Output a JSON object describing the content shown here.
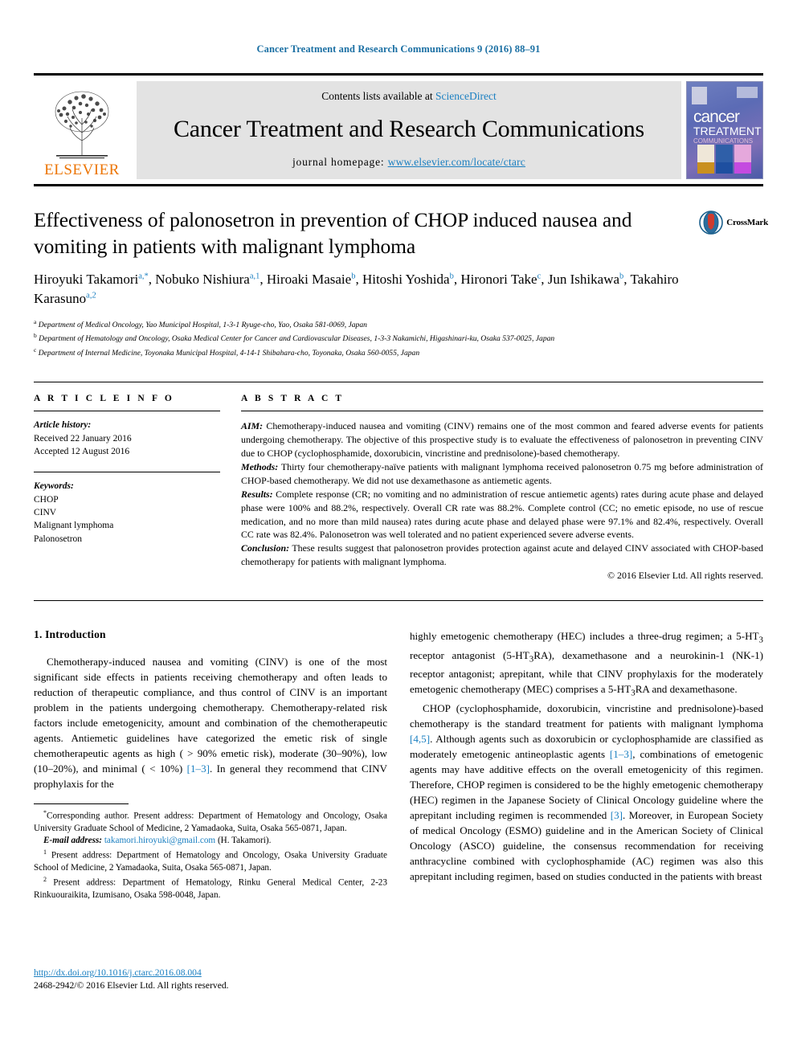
{
  "running_head": "Cancer Treatment and Research Communications 9 (2016) 88–91",
  "masthead": {
    "contents_prefix": "Contents lists available at ",
    "sciencedirect": "ScienceDirect",
    "journal_title": "Cancer Treatment and Research Communications",
    "homepage_prefix": "journal homepage: ",
    "homepage_url": "www.elsevier.com/locate/ctarc",
    "publisher_wordmark": "ELSEVIER",
    "cover": {
      "line1": "cancer",
      "line2": "TREATMENT",
      "line3": "COMMUNICATIONS"
    }
  },
  "article": {
    "title": "Effectiveness of palonosetron in prevention of CHOP induced nausea and vomiting in patients with malignant lymphoma",
    "crossmark_label": "CrossMark",
    "authors": [
      {
        "name": "Hiroyuki Takamori",
        "marks": "a,*"
      },
      {
        "name": "Nobuko Nishiura",
        "marks": "a,1"
      },
      {
        "name": "Hiroaki Masaie",
        "marks": "b"
      },
      {
        "name": "Hitoshi Yoshida",
        "marks": "b"
      },
      {
        "name": "Hironori Take",
        "marks": "c"
      },
      {
        "name": "Jun Ishikawa",
        "marks": "b"
      },
      {
        "name": "Takahiro Karasuno",
        "marks": "a,2"
      }
    ],
    "affiliations": [
      {
        "mark": "a",
        "text": "Department of Medical Oncology, Yao Municipal Hospital, 1-3-1 Ryuge-cho, Yao, Osaka 581-0069, Japan"
      },
      {
        "mark": "b",
        "text": "Department of Hematology and Oncology, Osaka Medical Center for Cancer and Cardiovascular Diseases, 1-3-3 Nakamichi, Higashinari-ku, Osaka 537-0025, Japan"
      },
      {
        "mark": "c",
        "text": "Department of Internal Medicine, Toyonaka Municipal Hospital, 4-14-1 Shibahara-cho, Toyonaka, Osaka 560-0055, Japan"
      }
    ]
  },
  "article_info": {
    "heading": "A R T I C L E   I N F O",
    "history_label": "Article history:",
    "received": "Received 22 January 2016",
    "accepted": "Accepted 12 August 2016",
    "keywords_label": "Keywords:",
    "keywords": [
      "CHOP",
      "CINV",
      "Malignant lymphoma",
      "Palonosetron"
    ]
  },
  "abstract": {
    "heading": "A B S T R A C T",
    "sections": [
      {
        "label": "AIM:",
        "text": " Chemotherapy-induced nausea and vomiting (CINV) remains one of the most common and feared adverse events for patients undergoing chemotherapy. The objective of this prospective study is to evaluate the effectiveness of palonosetron in preventing CINV due to CHOP (cyclophosphamide, doxorubicin, vincristine and prednisolone)-based chemotherapy."
      },
      {
        "label": "Methods:",
        "text": " Thirty four chemotherapy-naïve patients with malignant lymphoma received palonosetron 0.75 mg before administration of CHOP-based chemotherapy. We did not use dexamethasone as antiemetic agents."
      },
      {
        "label": "Results:",
        "text": " Complete response (CR; no vomiting and no administration of rescue antiemetic agents) rates during acute phase and delayed phase were 100% and 88.2%, respectively. Overall CR rate was 88.2%. Complete control (CC; no emetic episode, no use of rescue medication, and no more than mild nausea) rates during acute phase and delayed phase were 97.1% and 82.4%, respectively. Overall CC rate was 82.4%. Palonosetron was well tolerated and no patient experienced severe adverse events."
      },
      {
        "label": "Conclusion:",
        "text": " These results suggest that palonosetron provides protection against acute and delayed CINV associated with CHOP-based chemotherapy for patients with malignant lymphoma."
      }
    ],
    "copyright": "© 2016 Elsevier Ltd. All rights reserved."
  },
  "body": {
    "section_heading": "1.  Introduction",
    "left_paragraphs": [
      "Chemotherapy-induced nausea and vomiting (CINV) is one of the most significant side effects in patients receiving chemotherapy and often leads to reduction of therapeutic compliance, and thus control of CINV is an important problem in the patients undergoing chemotherapy. Chemotherapy-related risk factors include emetogenicity, amount and combination of the chemotherapeutic agents. Antiemetic guidelines have categorized the emetic risk of single chemotherapeutic agents as high ( > 90% emetic risk), moderate (30–90%), low (10–20%), and minimal ( < 10%) [1–3]. In general they recommend that CINV prophylaxis for the"
    ],
    "right_paragraphs": [
      "highly emetogenic chemotherapy (HEC) includes a three-drug regimen; a 5-HT3 receptor antagonist (5-HT3RA), dexamethasone and a neurokinin-1 (NK-1) receptor antagonist; aprepitant, while that CINV prophylaxis for the moderately emetogenic chemotherapy (MEC) comprises a 5-HT3RA and dexamethasone.",
      "CHOP (cyclophosphamide, doxorubicin, vincristine and prednisolone)-based chemotherapy is the standard treatment for patients with malignant lymphoma [4,5]. Although agents such as doxorubicin or cyclophosphamide are classified as moderately emetogenic antineoplastic agents [1–3], combinations of emetogenic agents may have additive effects on the overall emetogenicity of this regimen. Therefore, CHOP regimen is considered to be the highly emetogenic chemotherapy (HEC) regimen in the Japanese Society of Clinical Oncology guideline where the aprepitant including regimen is recommended [3]. Moreover, in European Society of medical Oncology (ESMO) guideline and in the American Society of Clinical Oncology (ASCO) guideline, the consensus recommendation for receiving anthracycline combined with cyclophosphamide (AC) regimen was also this aprepitant including regimen, based on studies conducted in the patients with breast"
    ]
  },
  "footnotes": {
    "corresponding": "Corresponding author. Present address: Department of Hematology and Oncology, Osaka University Graduate School of Medicine, 2 Yamadaoka, Suita, Osaka 565-0871, Japan.",
    "email_label": "E-mail address:",
    "email": "takamori.hiroyuki@gmail.com",
    "email_owner": "(H. Takamori).",
    "note1": "Present address: Department of Hematology and Oncology, Osaka University Graduate School of Medicine, 2 Yamadaoka, Suita, Osaka 565-0871, Japan.",
    "note2": "Present address: Department of Hematology, Rinku General Medical Center, 2-23 Rinkuouraikita, Izumisano, Osaka 598-0048, Japan."
  },
  "footer": {
    "doi": "http://dx.doi.org/10.1016/j.ctarc.2016.08.004",
    "issn_line": "2468-2942/© 2016 Elsevier Ltd. All rights reserved."
  },
  "colors": {
    "link": "#1a7fc1",
    "running_head": "#1a6fa3",
    "elsevier_orange": "#ec7404"
  }
}
